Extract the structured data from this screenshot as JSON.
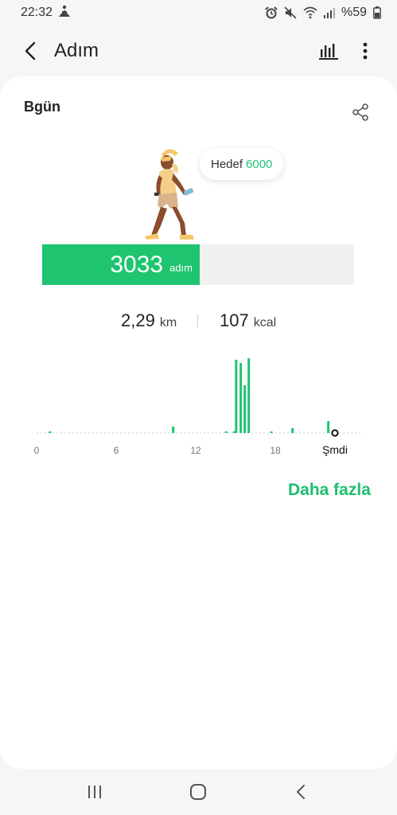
{
  "status_bar": {
    "time": "22:32",
    "battery": "%59",
    "icons": [
      "yoga-icon",
      "alarm-icon",
      "mute-icon",
      "wifi-icon",
      "signal-icon",
      "battery-icon"
    ]
  },
  "app_bar": {
    "title": "Adım",
    "icons": [
      "back-arrow-icon",
      "bar-chart-icon",
      "more-vert-icon"
    ]
  },
  "card": {
    "title": "Bgün",
    "goal_label": "Hedef",
    "goal_value": "6000",
    "steps": "3033",
    "steps_unit": "adım",
    "progress": 0.5055,
    "distance_value": "2,29",
    "distance_unit": "km",
    "calories_value": "107",
    "calories_unit": "kcal",
    "more_link": "Daha fazla"
  },
  "colors": {
    "accent": "#1ec46f",
    "track": "#f0f0f0",
    "link": "#1ebf6d"
  },
  "chart_data": {
    "type": "bar",
    "x_tick_labels": [
      "0",
      "6",
      "12",
      "18",
      "Şmdi"
    ],
    "x": [
      1,
      10.3,
      14.3,
      14.9,
      15.05,
      15.4,
      15.7,
      16.0,
      17.7,
      19.3,
      22.0
    ],
    "values": [
      2,
      8,
      1,
      2,
      92,
      88,
      60,
      94,
      2,
      6,
      15
    ],
    "xlim": [
      0,
      24
    ],
    "current_hour": 22.5
  },
  "nav_bar": {
    "icons": [
      "recent-apps-icon",
      "home-icon",
      "nav-back-icon"
    ]
  }
}
